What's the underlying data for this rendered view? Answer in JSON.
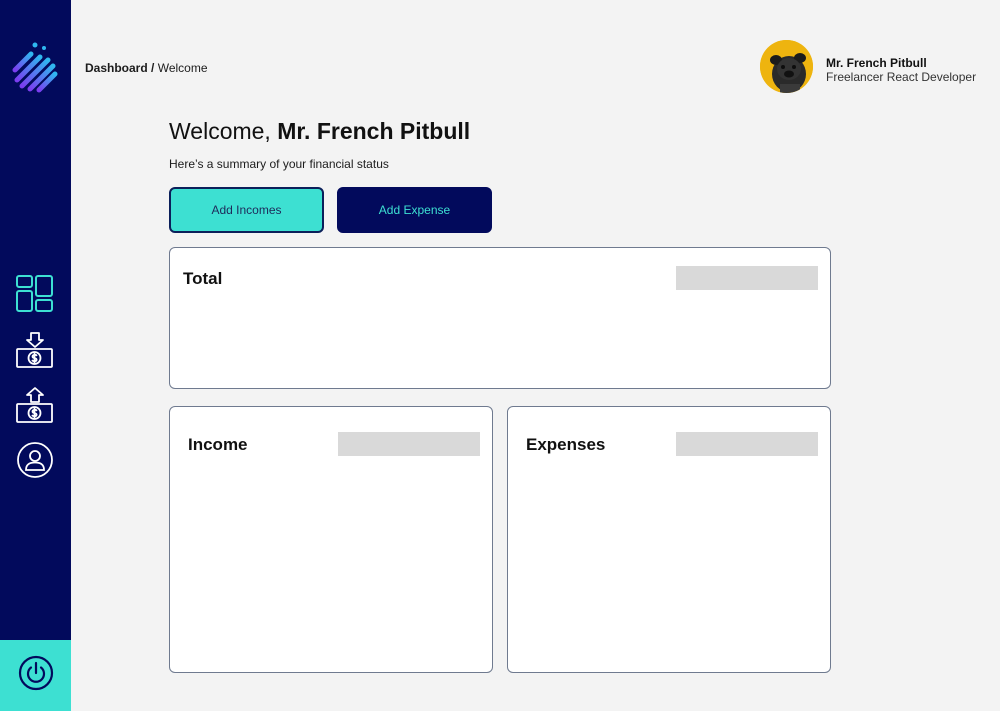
{
  "sidebar": {
    "logo_icon": "striped-diamond-logo",
    "items": [
      {
        "name": "dashboard",
        "icon": "dashboard-grid-icon"
      },
      {
        "name": "incomes",
        "icon": "money-down-arrow-icon"
      },
      {
        "name": "expenses",
        "icon": "money-up-arrow-icon"
      },
      {
        "name": "profile",
        "icon": "user-circle-icon"
      }
    ],
    "logout_icon": "power-icon"
  },
  "breadcrumb": {
    "section": "Dashboard",
    "separator": " / ",
    "page": "Welcome"
  },
  "profile": {
    "name": "Mr. French Pitbull",
    "role": "Freelancer React Developer"
  },
  "main": {
    "welcome_prefix": "Welcome, ",
    "user_name": "Mr. French Pitbull",
    "summary": "Here’s a summary of your financial status",
    "add_incomes_label": "Add Incomes",
    "add_expense_label": "Add Expense"
  },
  "cards": {
    "total_title": "Total",
    "income_title": "Income",
    "expenses_title": "Expenses"
  },
  "colors": {
    "sidebar_bg": "#020a5c",
    "accent": "#3de0d2",
    "background": "#f3f3f3",
    "placeholder": "#d9d9d9"
  }
}
